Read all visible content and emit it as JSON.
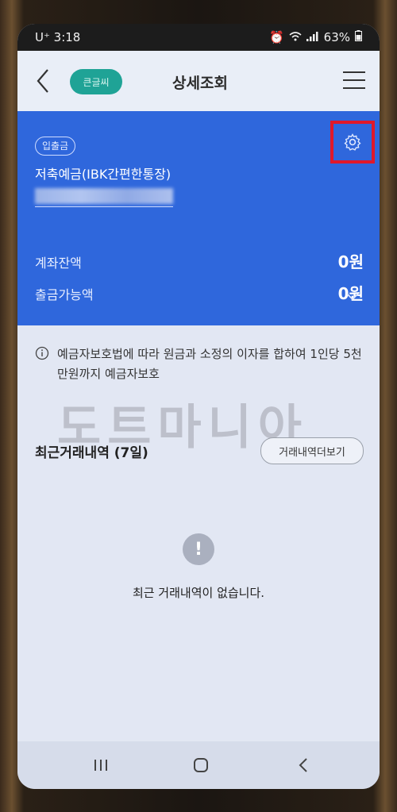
{
  "status_bar": {
    "carrier_time": "U⁺ 3:18",
    "battery": "63%"
  },
  "header": {
    "pill_label": "큰글씨",
    "title": "상세조회"
  },
  "account_card": {
    "badge": "입출금",
    "account_name": "저축예금(IBK간편한통장)",
    "balance_label": "계좌잔액",
    "balance_value": "0원",
    "withdrawable_label": "출금가능액",
    "withdrawable_value": "0원",
    "highlight_color": "#e0182a",
    "card_color": "#2f67dc"
  },
  "notice": {
    "text": "예금자보호법에 따라 원금과 소정의 이자를 합하여 1인당 5천만원까지 예금자보호"
  },
  "watermark": "도트마니아",
  "transactions": {
    "section_title": "최근거래내역 (7일)",
    "more_button": "거래내역더보기",
    "empty_icon": "!",
    "empty_text": "최근 거래내역이 없습니다."
  },
  "icons": {
    "back": "chevron-left-icon",
    "menu": "hamburger-icon",
    "settings": "gear-icon",
    "info": "info-icon",
    "expand": "chevron-down-icon"
  }
}
